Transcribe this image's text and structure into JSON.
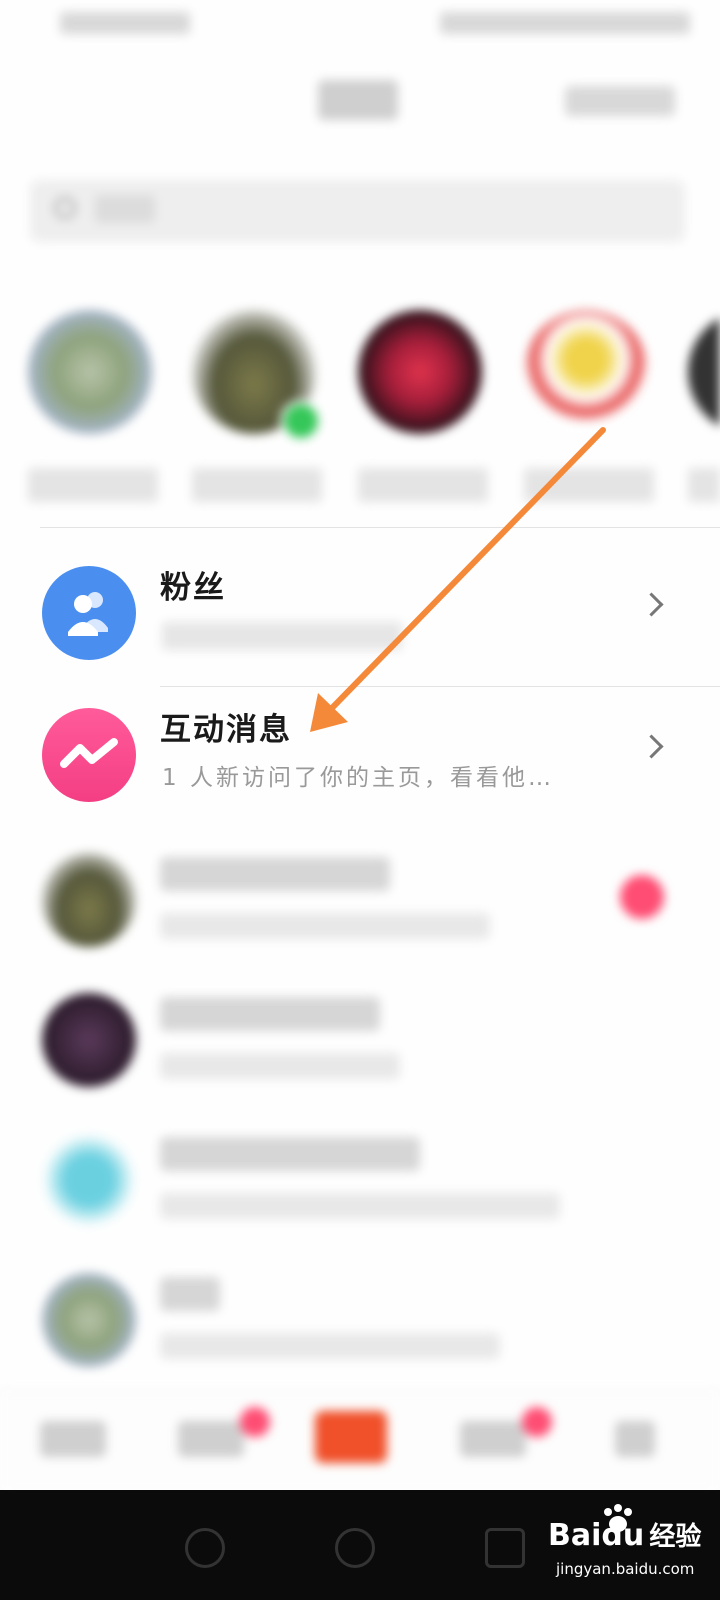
{
  "rows": {
    "fans": {
      "title": "粉丝"
    },
    "interactions": {
      "title": "互动消息",
      "subtitle": "1 人新访问了你的主页，看看他…"
    }
  },
  "watermark": {
    "brand": "Baidu",
    "brand_cn": "经验",
    "url": "jingyan.baidu.com"
  },
  "colors": {
    "fans_icon": "#4a8ff0",
    "interactions_icon": "#f43e84",
    "annotation_arrow": "#f5893a",
    "unread_badge": "#ff4d73"
  },
  "icons": {
    "fans": "people-icon",
    "interactions": "zigzag-icon",
    "chevron": "chevron-right-icon",
    "search": "search-icon"
  }
}
